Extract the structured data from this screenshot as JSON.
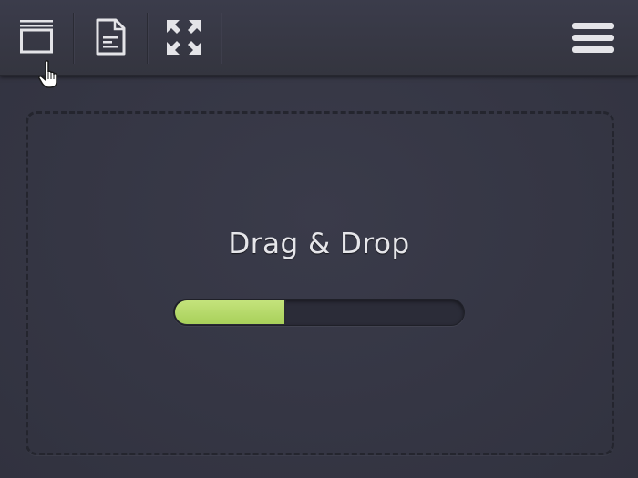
{
  "toolbar": {
    "buttons": [
      {
        "name": "window-icon"
      },
      {
        "name": "document-icon"
      },
      {
        "name": "expand-icon"
      }
    ],
    "menu_icon": "hamburger-menu-icon"
  },
  "dropzone": {
    "title": "Drag & Drop",
    "progress": 0.38
  },
  "colors": {
    "background": "#353645",
    "progress_fill": "#a8d05a",
    "text": "#e6e6ea"
  }
}
